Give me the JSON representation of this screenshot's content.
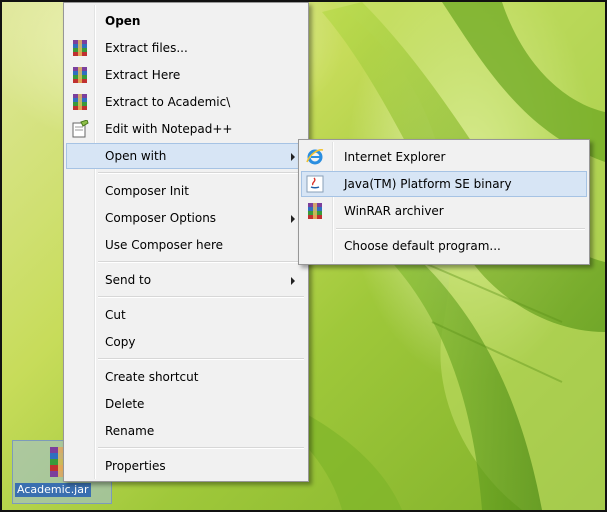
{
  "desktop": {
    "icon_label": "Academic.jar",
    "icon": "winrar-archive-icon"
  },
  "context_menu": {
    "items": [
      {
        "label": "Open",
        "bold": true
      },
      {
        "label": "Extract files...",
        "icon": "winrar-icon"
      },
      {
        "label": "Extract Here",
        "icon": "winrar-icon"
      },
      {
        "label": "Extract to Academic\\",
        "icon": "winrar-icon"
      },
      {
        "label": "Edit with Notepad++",
        "icon": "notepad-plus-plus-icon"
      },
      {
        "label": "Open with",
        "submenu": true,
        "highlighted": true
      },
      {
        "label": "Composer Init"
      },
      {
        "label": "Composer Options",
        "submenu": true
      },
      {
        "label": "Use Composer here"
      },
      {
        "label": "Send to",
        "submenu": true
      },
      {
        "label": "Cut"
      },
      {
        "label": "Copy"
      },
      {
        "label": "Create shortcut"
      },
      {
        "label": "Delete"
      },
      {
        "label": "Rename"
      },
      {
        "label": "Properties"
      }
    ]
  },
  "open_with_menu": {
    "items": [
      {
        "label": "Internet Explorer",
        "icon": "internet-explorer-icon"
      },
      {
        "label": "Java(TM) Platform SE binary",
        "icon": "java-icon",
        "highlighted": true
      },
      {
        "label": "WinRAR archiver",
        "icon": "winrar-icon"
      },
      {
        "label": "Choose default program..."
      }
    ]
  },
  "colors": {
    "menu_bg": "#f1f1f1",
    "highlight_bg": "#d7e5f5",
    "highlight_border": "#a6c3e4",
    "selection_label_bg": "#3a6fb0"
  }
}
